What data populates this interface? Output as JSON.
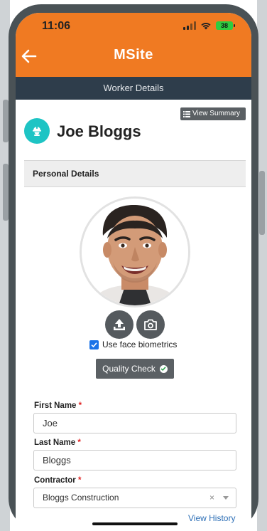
{
  "status": {
    "time": "11:06",
    "battery": "38"
  },
  "header": {
    "logo_text": "MSite",
    "brand_color": "#f07a22"
  },
  "titlebar": {
    "title": "Worker Details"
  },
  "summary_button": {
    "label": "View Summary",
    "icon": "list-icon"
  },
  "worker": {
    "name": "Joe Bloggs",
    "avatar_icon": "worker-helmet-icon"
  },
  "section": {
    "title": "Personal Details"
  },
  "photo": {
    "upload_icon": "upload-icon",
    "camera_icon": "camera-icon"
  },
  "biometrics": {
    "label": "Use face biometrics",
    "checked": true
  },
  "quality_check": {
    "label": "Quality Check",
    "icon": "check-icon"
  },
  "form": {
    "first_name": {
      "label": "First Name",
      "required_mark": "*",
      "value": "Joe"
    },
    "last_name": {
      "label": "Last Name",
      "required_mark": "*",
      "value": "Bloggs"
    },
    "contractor": {
      "label": "Contractor",
      "required_mark": "*",
      "value": "Bloggs Construction",
      "clear": "×"
    }
  },
  "links": {
    "view_history": "View History"
  },
  "colors": {
    "header": "#f07a22",
    "titlebar": "#2e3d4b",
    "accent": "#1ec4c4",
    "link": "#2d6fb6"
  }
}
